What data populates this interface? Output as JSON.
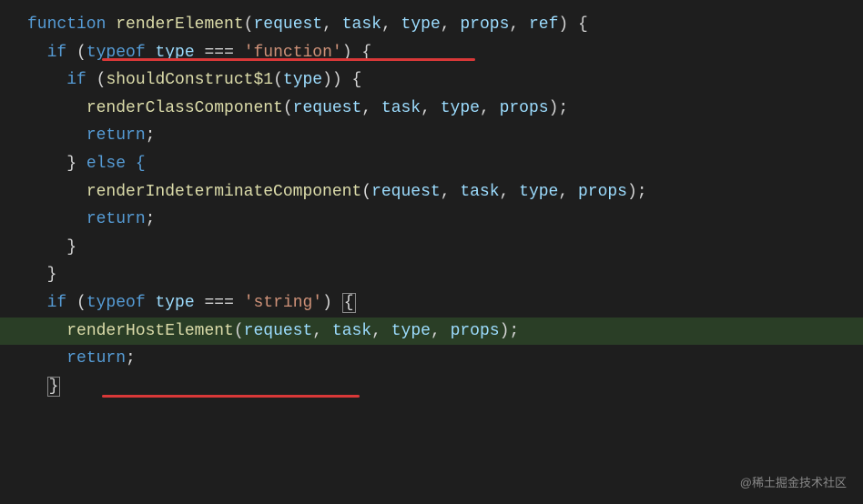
{
  "code": {
    "t1": "function",
    "t2": " ",
    "t3": "renderElement",
    "t4": "(",
    "t5": "request",
    "t6": ", ",
    "t7": "task",
    "t8": ", ",
    "t9": "type",
    "t10": ", ",
    "t11": "props",
    "t12": ", ",
    "t13": "ref",
    "t14": ") {",
    "indent1": "  ",
    "indent2": "    ",
    "indent3": "      ",
    "if": "if",
    "lparen": " (",
    "typeof": "typeof",
    "sp": " ",
    "type": "type",
    "eqeq": " === ",
    "strFunction": "'function'",
    "rparen_brace": ") {",
    "shouldConstruct": "shouldConstruct$1",
    "lp": "(",
    "rp_rp_brace": ")) {",
    "renderClassComponent": "renderClassComponent",
    "request": "request",
    "comma": ", ",
    "task": "task",
    "props": "props",
    "rp_semi": ");",
    "return": "return",
    "semi": ";",
    "rbrace": "}",
    "else": " else {",
    "renderIndeterminate": "renderIndeterminateComponent",
    "strString": "'string'",
    "renderHostElement": "renderHostElement",
    "empty": ""
  },
  "watermark": "@稀土掘金技术社区"
}
